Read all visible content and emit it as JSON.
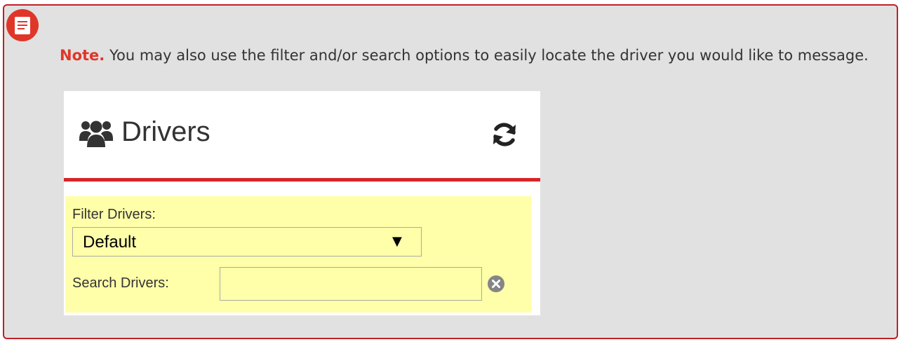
{
  "note": {
    "icon": "note-icon",
    "label": "Note.",
    "text": " You may also use the filter and/or search options to easily locate the driver you would like to message.",
    "colors": {
      "border": "#c0202a",
      "label": "#e0362a",
      "background": "#e1e1e1"
    }
  },
  "drivers_panel": {
    "title_icon": "users-icon",
    "title": "Drivers",
    "refresh_icon": "refresh-icon",
    "accent_color": "#d8232a",
    "filter_background": "#ffffaa",
    "filter": {
      "label": "Filter Drivers:",
      "selected_value": "Default",
      "arrow_icon": "dropdown-arrow-icon"
    },
    "search": {
      "label": "Search Drivers:",
      "value": "",
      "clear_icon": "clear-icon"
    }
  }
}
